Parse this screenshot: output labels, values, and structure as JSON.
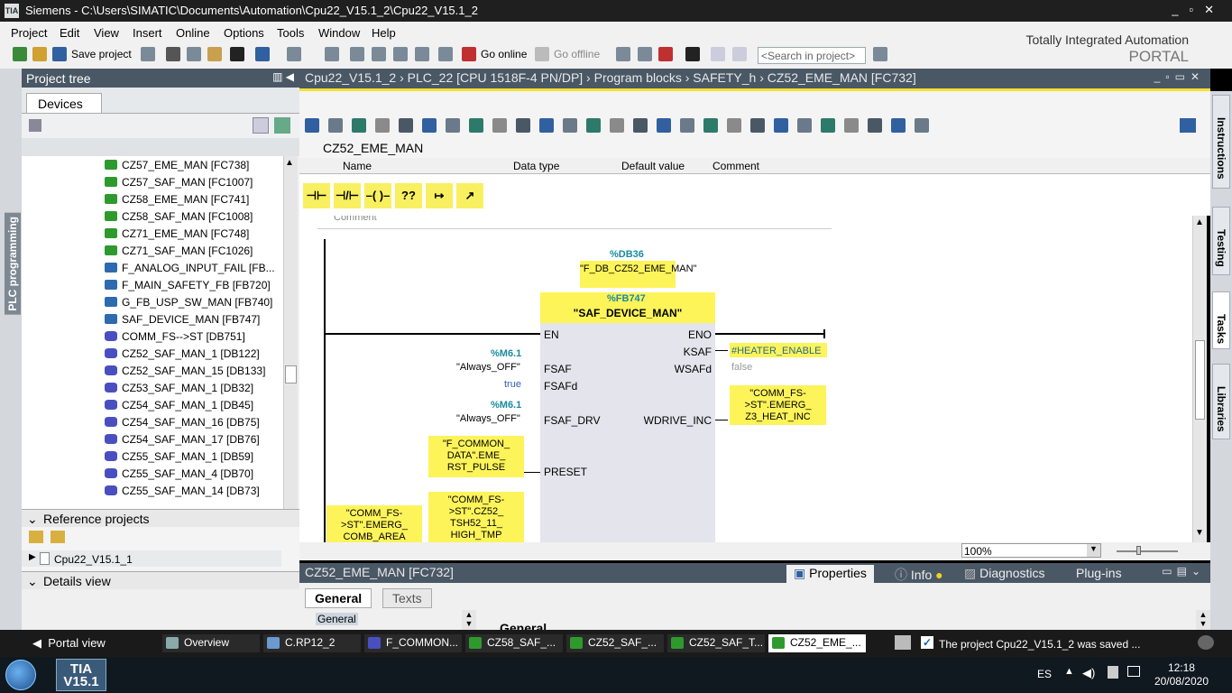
{
  "window": {
    "app_icon": "TIA",
    "title": "Siemens  -  C:\\Users\\SIMATIC\\Documents\\Automation\\Cpu22_V15.1_2\\Cpu22_V15.1_2",
    "controls": [
      "_",
      "▫",
      "✕"
    ]
  },
  "menu": [
    "Project",
    "Edit",
    "View",
    "Insert",
    "Online",
    "Options",
    "Tools",
    "Window",
    "Help"
  ],
  "toolbar": {
    "save_label": "Save project",
    "go_online": "Go online",
    "go_offline": "Go offline",
    "search_placeholder": "<Search in project>"
  },
  "brand": {
    "line1": "Totally Integrated Automation",
    "line2": "PORTAL"
  },
  "left_strip_label": "PLC programming",
  "project_tree": {
    "title": "Project tree",
    "tab": "Devices",
    "items": [
      {
        "label": "CZ57_EME_MAN [FC738]",
        "icon": "fc-block-icon"
      },
      {
        "label": "CZ57_SAF_MAN [FC1007]",
        "icon": "fc-block-icon"
      },
      {
        "label": "CZ58_EME_MAN [FC741]",
        "icon": "fc-block-icon"
      },
      {
        "label": "CZ58_SAF_MAN [FC1008]",
        "icon": "fc-block-icon"
      },
      {
        "label": "CZ71_EME_MAN [FC748]",
        "icon": "fc-block-icon"
      },
      {
        "label": "CZ71_SAF_MAN [FC1026]",
        "icon": "fc-block-icon"
      },
      {
        "label": "F_ANALOG_INPUT_FAIL [FB...",
        "icon": "fb-block-icon"
      },
      {
        "label": "F_MAIN_SAFETY_FB [FB720]",
        "icon": "fb-block-icon"
      },
      {
        "label": "G_FB_USP_SW_MAN [FB740]",
        "icon": "fb-block-icon"
      },
      {
        "label": "SAF_DEVICE_MAN [FB747]",
        "icon": "fb-block-icon"
      },
      {
        "label": "COMM_FS-->ST [DB751]",
        "icon": "db-block-icon"
      },
      {
        "label": "CZ52_SAF_MAN_1 [DB122]",
        "icon": "db-block-icon"
      },
      {
        "label": "CZ52_SAF_MAN_15 [DB133]",
        "icon": "db-block-icon"
      },
      {
        "label": "CZ53_SAF_MAN_1 [DB32]",
        "icon": "db-block-icon"
      },
      {
        "label": "CZ54_SAF_MAN_1 [DB45]",
        "icon": "db-block-icon"
      },
      {
        "label": "CZ54_SAF_MAN_16 [DB75]",
        "icon": "db-block-icon"
      },
      {
        "label": "CZ54_SAF_MAN_17 [DB76]",
        "icon": "db-block-icon"
      },
      {
        "label": "CZ55_SAF_MAN_1 [DB59]",
        "icon": "db-block-icon"
      },
      {
        "label": "CZ55_SAF_MAN_4 [DB70]",
        "icon": "db-block-icon"
      },
      {
        "label": "CZ55_SAF_MAN_14 [DB73]",
        "icon": "db-block-icon"
      }
    ],
    "reference_projects": "Reference projects",
    "ref_item": "Cpu22_V15.1_1",
    "details_view": "Details view"
  },
  "editor": {
    "breadcrumb": "Cpu22_V15.1_2  ›  PLC_22 [CPU 1518F-4 PN/DP]  ›  Program blocks  ›  SAFETY_h  ›  CZ52_EME_MAN [FC732]",
    "block_name": "CZ52_EME_MAN",
    "columns": [
      "Name",
      "Data type",
      "Default value",
      "Comment"
    ],
    "ladder_buttons": [
      "⊣⊢",
      "⊣/⊢",
      "–( )–",
      "??",
      "↦",
      "↗"
    ],
    "network_comment": "Comment",
    "instance_db_addr": "%DB36",
    "instance_db_name": "\"F_DB_CZ52_EME_MAN\"",
    "fb_addr": "%FB747",
    "fb_name": "\"SAF_DEVICE_MAN\"",
    "pins_in": [
      "EN",
      "FSAF",
      "FSAFd",
      "FSAF_DRV",
      "PRESET"
    ],
    "pins_out": [
      "ENO",
      "KSAF",
      "WSAFd",
      "WDRIVE_INC"
    ],
    "fsaf_addr": "%M6.1",
    "fsaf_tag": "\"Always_OFF\"",
    "fsafd_value": "true",
    "fsafdrv_addr": "%M6.1",
    "fsafdrv_tag": "\"Always_OFF\"",
    "preset_tag": "\"F_COMMON_ DATA\".EME_ RST_PULSE",
    "ksaf_tag": "#HEATER_ENABLE",
    "wsafd_value": "false",
    "wdrive_tag": "\"COMM_FS- >ST\".EMERG_ Z3_HEAT_INC",
    "bottom_tag1": "\"COMM_FS- >ST\".EMERG_ COMB_AREA",
    "bottom_tag2": "\"COMM_FS- >ST\".CZ52_ TSH52_11_ HIGH_TMP",
    "zoom": "100%"
  },
  "right_tabs": [
    "Instructions",
    "Testing",
    "Tasks",
    "Libraries"
  ],
  "properties": {
    "title": "CZ52_EME_MAN [FC732]",
    "tabs": [
      "Properties",
      "Info",
      "Diagnostics",
      "Plug-ins"
    ],
    "subtabs": [
      "General",
      "Texts"
    ],
    "nav_item": "General",
    "section": "General"
  },
  "statusbar": {
    "portal_view": "Portal view",
    "tabs": [
      "Overview",
      "C.RP12_2",
      "F_COMMON...",
      "CZ58_SAF_...",
      "CZ52_SAF_...",
      "CZ52_SAF_T...",
      "CZ52_EME_..."
    ],
    "message": "The project Cpu22_V15.1_2 was saved ..."
  },
  "taskbar": {
    "tia_label": "TIA V15.1",
    "lang": "ES",
    "time": "12:18",
    "date": "20/08/2020"
  }
}
